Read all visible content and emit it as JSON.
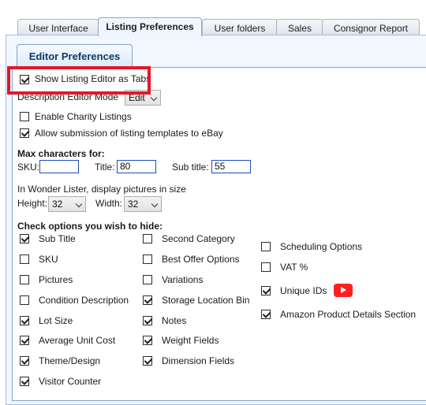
{
  "tabs": [
    {
      "label": "User Interface"
    },
    {
      "label": "Listing Preferences"
    },
    {
      "label": "User folders"
    },
    {
      "label": "Sales"
    },
    {
      "label": "Consignor Report"
    }
  ],
  "group_title": "Editor Preferences",
  "general": {
    "show_listing_editor_tabs": "Show Listing Editor as Tabs",
    "description_editor_mode_label": "Description Editor Mode",
    "description_editor_mode_value": "Edit",
    "enable_charity": "Enable Charity Listings",
    "allow_templates": "Allow submission of listing templates to eBay"
  },
  "max_chars": {
    "heading": "Max characters for:",
    "sku_label": "SKU:",
    "sku_value": "",
    "title_label": "Title:",
    "title_value": "80",
    "subtitle_label": "Sub title:",
    "subtitle_value": "55"
  },
  "pictures": {
    "caption": "In Wonder Lister, display pictures in size",
    "height_label": "Height:",
    "height_value": "32",
    "width_label": "Width:",
    "width_value": "32"
  },
  "hide": {
    "heading": "Check options you wish to hide:",
    "col1": [
      {
        "label": "Sub Title",
        "checked": true
      },
      {
        "label": "SKU",
        "checked": false
      },
      {
        "label": "Pictures",
        "checked": false
      },
      {
        "label": "Condition Description",
        "checked": false
      },
      {
        "label": "Lot Size",
        "checked": true
      },
      {
        "label": "Average Unit Cost",
        "checked": true
      },
      {
        "label": "Theme/Design",
        "checked": true
      },
      {
        "label": "Visitor Counter",
        "checked": true
      }
    ],
    "col2": [
      {
        "label": "Second Category",
        "checked": false
      },
      {
        "label": "Best Offer Options",
        "checked": false
      },
      {
        "label": "Variations",
        "checked": false
      },
      {
        "label": "Storage Location Bin",
        "checked": true
      },
      {
        "label": "Notes",
        "checked": true
      },
      {
        "label": "Weight Fields",
        "checked": true
      },
      {
        "label": "Dimension Fields",
        "checked": true
      }
    ],
    "col3": [
      {
        "label": "Scheduling Options",
        "checked": false
      },
      {
        "label": "VAT %",
        "checked": false
      },
      {
        "label": "Unique IDs",
        "checked": true,
        "icon": "youtube-icon"
      },
      {
        "label": "Amazon Product Details Section",
        "checked": true
      }
    ]
  }
}
